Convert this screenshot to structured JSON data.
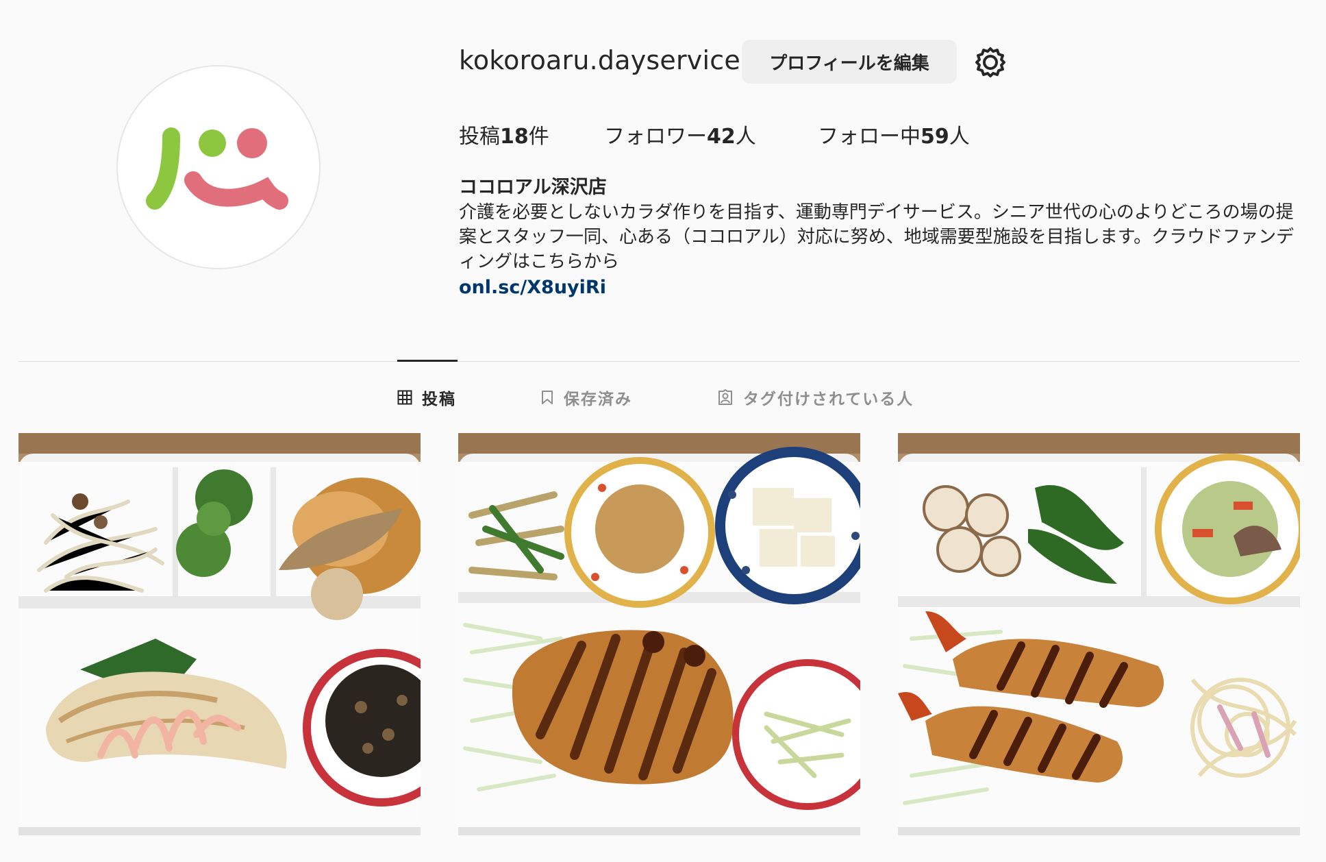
{
  "profile": {
    "username": "kokoroaru.dayservice",
    "edit_button": "プロフィールを編集",
    "logo_colors": {
      "green": "#8dc63f",
      "pink": "#e06f7b"
    }
  },
  "stats": {
    "posts_label": "投稿",
    "posts_count": "18",
    "posts_unit": "件",
    "followers_label": "フォロワー",
    "followers_count": "42",
    "followers_unit": "人",
    "following_label": "フォロー中",
    "following_count": "59",
    "following_unit": "人"
  },
  "bio": {
    "name": "ココロアル深沢店",
    "text": "介護を必要としないカラダ作りを目指す、運動専門デイサービス。シニア世代の心のよりどころの場の提案とスタッフ一同、心ある（ココロアル）対応に努め、地域需要型施設を目指します。クラウドファンディングはこちらから",
    "link": "onl.sc/X8uyiRi"
  },
  "tabs": [
    {
      "label": "投稿",
      "icon": "grid-icon",
      "active": true
    },
    {
      "label": "保存済み",
      "icon": "bookmark-icon",
      "active": false
    },
    {
      "label": "タグ付けされている人",
      "icon": "tagged-person-icon",
      "active": false
    }
  ],
  "colors": {
    "link": "#00376b",
    "button_bg": "#efefef",
    "divider": "#dbdbdb"
  }
}
